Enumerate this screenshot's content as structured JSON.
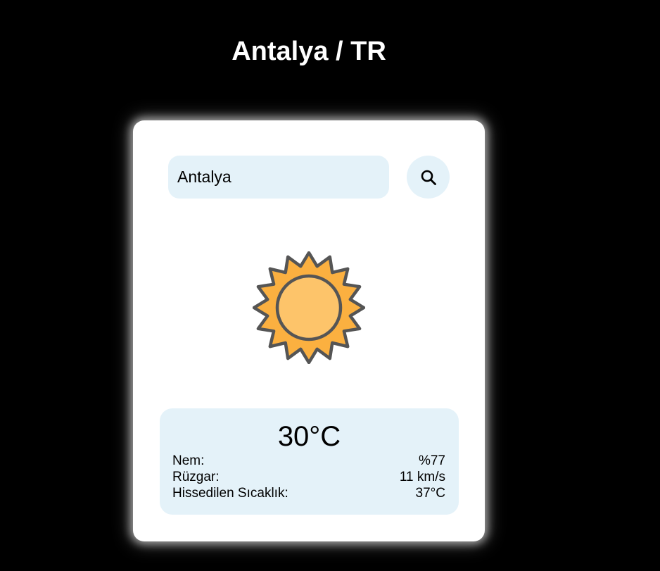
{
  "header": {
    "title": "Antalya / TR"
  },
  "search": {
    "value": "Antalya",
    "placeholder": ""
  },
  "weather": {
    "icon": "sun-icon",
    "temperature": "30°C",
    "details": [
      {
        "label": "Nem:",
        "value": "%77"
      },
      {
        "label": "Rüzgar:",
        "value": "11 km/s"
      },
      {
        "label": "Hissedilen Sıcaklık:",
        "value": "37°C"
      }
    ]
  },
  "colors": {
    "background": "#000000",
    "card": "#ffffff",
    "panel": "#e4f2f9",
    "sun_outer": "#fbb040",
    "sun_inner": "#fdc46a",
    "sun_stroke": "#555555"
  }
}
